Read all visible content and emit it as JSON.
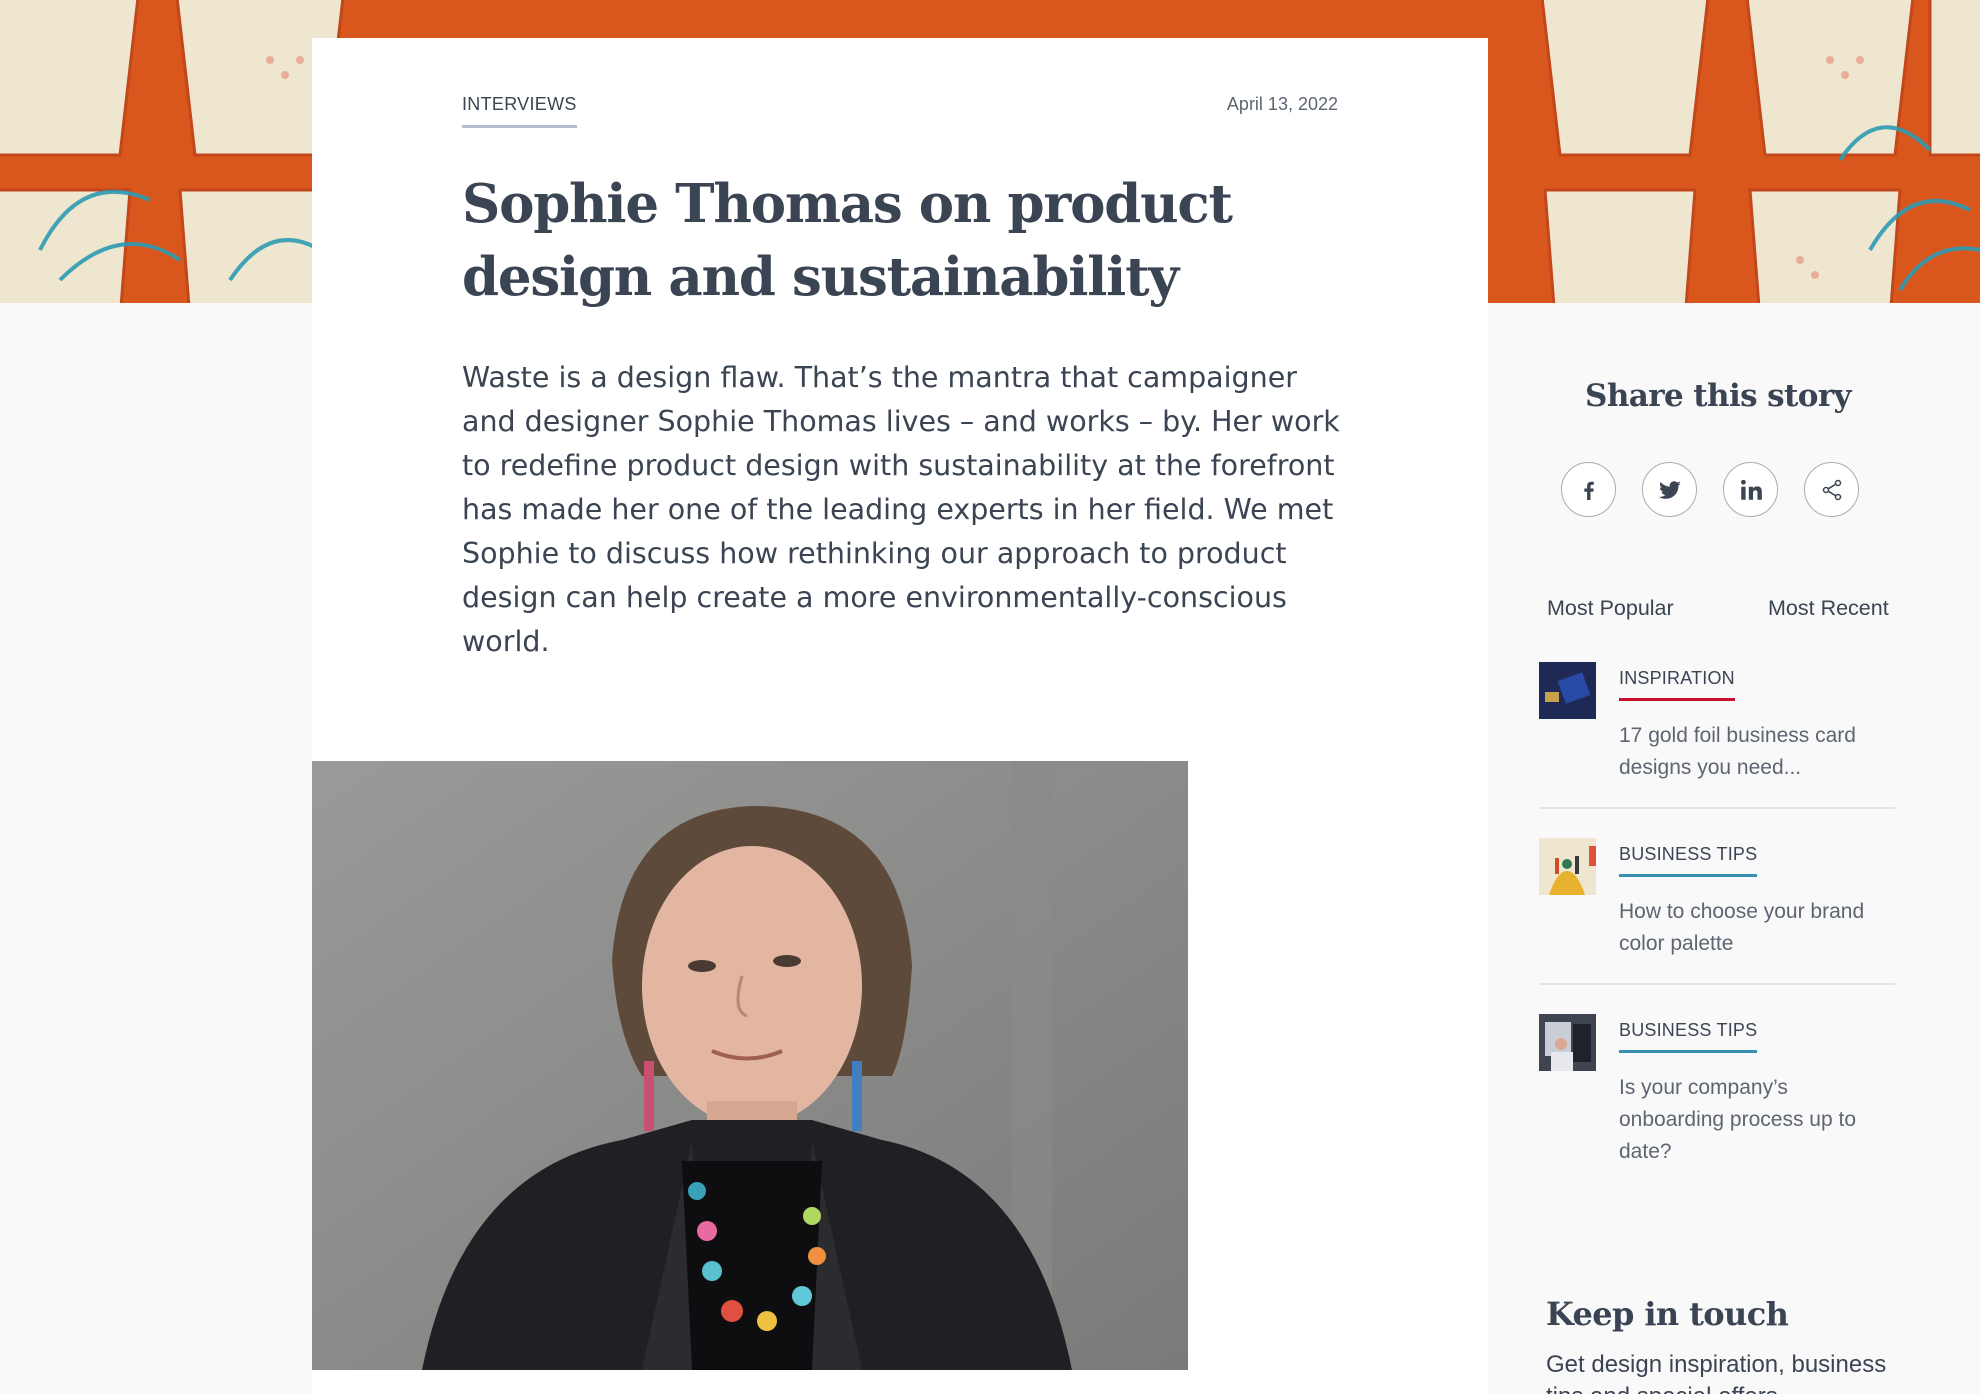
{
  "article": {
    "category": "INTERVIEWS",
    "date": "April 13, 2022",
    "title": "Sophie Thomas on product design and sustainability",
    "lede": "Waste is a design flaw. That’s the mantra that campaigner and designer Sophie Thomas lives – and works – by. Her work to redefine product design with sustainability at the forefront has made her one of the leading experts in her field. We met Sophie to discuss how rethinking our approach to product design can help create a more environmentally-conscious world."
  },
  "sidebar": {
    "share_title": "Share this story",
    "share_buttons": [
      {
        "icon": "facebook-icon"
      },
      {
        "icon": "twitter-icon"
      },
      {
        "icon": "linkedin-icon"
      },
      {
        "icon": "share-icon"
      }
    ],
    "tabs": [
      "Most Popular",
      "Most Recent"
    ],
    "stories": [
      {
        "category": "INSPIRATION",
        "headline": "17 gold foil business card designs you need...",
        "accent": "#c8102e"
      },
      {
        "category": "BUSINESS TIPS",
        "headline": "How to choose your brand color palette",
        "accent": "#3a8fb0"
      },
      {
        "category": "BUSINESS TIPS",
        "headline": "Is your company’s onboarding process up to date?",
        "accent": "#3a8fb0"
      }
    ],
    "keep_title": "Keep in touch",
    "keep_text": "Get design inspiration, business tips and special offers"
  },
  "colors": {
    "text": "#3b4453",
    "hero_orange": "#d9561c",
    "inspiration_accent": "#c8102e",
    "business_accent": "#3a8fb0"
  }
}
